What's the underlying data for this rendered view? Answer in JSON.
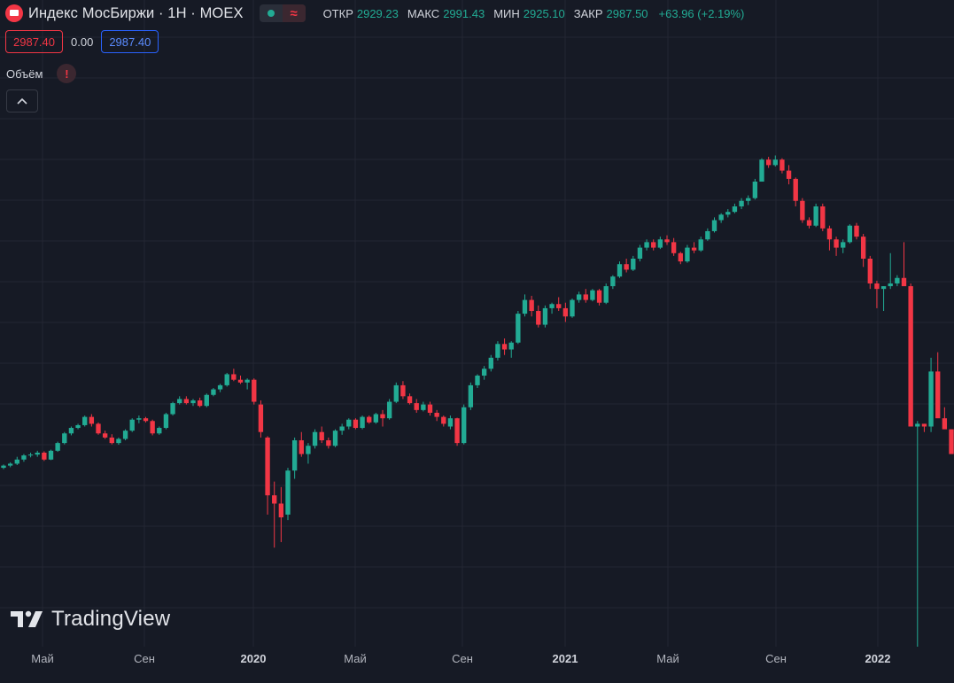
{
  "header": {
    "title": "Индекс МосБиржи · 1Н · MOEX",
    "ohlc": [
      {
        "key": "ОТКР",
        "value": "2929.23"
      },
      {
        "key": "МАКС",
        "value": "2991.43"
      },
      {
        "key": "МИН",
        "value": "2925.10"
      },
      {
        "key": "ЗАКР",
        "value": "2987.50"
      }
    ],
    "change": "+63.96 (+2.19%)"
  },
  "trade": {
    "sell": "2987.40",
    "spread": "0.00",
    "buy": "2987.40"
  },
  "volume": {
    "label": "Объём",
    "warning": "!"
  },
  "brand": {
    "name": "TradingView"
  },
  "colors": {
    "background": "#161a25",
    "grid": "#232632",
    "up": "#22ab94",
    "down": "#f23645"
  },
  "chart_data": {
    "type": "candlestick",
    "x_ticks": [
      {
        "label": "Май",
        "year": false
      },
      {
        "label": "Сен",
        "year": false
      },
      {
        "label": "2020",
        "year": true
      },
      {
        "label": "Май",
        "year": false
      },
      {
        "label": "Сен",
        "year": false
      },
      {
        "label": "2021",
        "year": true
      },
      {
        "label": "Май",
        "year": false
      },
      {
        "label": "Сен",
        "year": false
      },
      {
        "label": "2022",
        "year": true
      }
    ],
    "ylim": [
      2000,
      4350
    ],
    "grid": true,
    "candles": [
      [
        2650,
        2662,
        2645,
        2658
      ],
      [
        2658,
        2670,
        2652,
        2665
      ],
      [
        2665,
        2690,
        2660,
        2680
      ],
      [
        2680,
        2700,
        2672,
        2695
      ],
      [
        2695,
        2705,
        2688,
        2698
      ],
      [
        2698,
        2712,
        2690,
        2705
      ],
      [
        2705,
        2710,
        2675,
        2680
      ],
      [
        2680,
        2716,
        2678,
        2712
      ],
      [
        2712,
        2745,
        2708,
        2740
      ],
      [
        2740,
        2780,
        2735,
        2775
      ],
      [
        2775,
        2800,
        2768,
        2795
      ],
      [
        2795,
        2810,
        2790,
        2805
      ],
      [
        2805,
        2840,
        2800,
        2835
      ],
      [
        2835,
        2845,
        2800,
        2810
      ],
      [
        2810,
        2815,
        2770,
        2775
      ],
      [
        2775,
        2785,
        2755,
        2760
      ],
      [
        2760,
        2772,
        2735,
        2740
      ],
      [
        2740,
        2760,
        2734,
        2755
      ],
      [
        2755,
        2790,
        2750,
        2785
      ],
      [
        2785,
        2830,
        2780,
        2825
      ],
      [
        2825,
        2840,
        2812,
        2830
      ],
      [
        2830,
        2835,
        2815,
        2820
      ],
      [
        2820,
        2825,
        2768,
        2775
      ],
      [
        2775,
        2800,
        2770,
        2795
      ],
      [
        2795,
        2850,
        2790,
        2845
      ],
      [
        2845,
        2890,
        2840,
        2885
      ],
      [
        2885,
        2910,
        2880,
        2900
      ],
      [
        2900,
        2910,
        2880,
        2885
      ],
      [
        2885,
        2900,
        2875,
        2895
      ],
      [
        2895,
        2905,
        2870,
        2875
      ],
      [
        2875,
        2920,
        2870,
        2915
      ],
      [
        2915,
        2940,
        2910,
        2935
      ],
      [
        2935,
        2955,
        2925,
        2950
      ],
      [
        2950,
        2995,
        2945,
        2990
      ],
      [
        2990,
        3010,
        2965,
        2970
      ],
      [
        2970,
        2985,
        2955,
        2960
      ],
      [
        2960,
        2975,
        2935,
        2970
      ],
      [
        2970,
        2975,
        2880,
        2890
      ],
      [
        2880,
        2895,
        2760,
        2780
      ],
      [
        2760,
        2765,
        2480,
        2550
      ],
      [
        2550,
        2600,
        2360,
        2520
      ],
      [
        2520,
        2580,
        2380,
        2470
      ],
      [
        2480,
        2650,
        2460,
        2640
      ],
      [
        2640,
        2760,
        2610,
        2750
      ],
      [
        2750,
        2780,
        2690,
        2700
      ],
      [
        2700,
        2740,
        2665,
        2730
      ],
      [
        2730,
        2790,
        2720,
        2780
      ],
      [
        2780,
        2800,
        2740,
        2750
      ],
      [
        2750,
        2760,
        2720,
        2730
      ],
      [
        2730,
        2790,
        2725,
        2785
      ],
      [
        2785,
        2810,
        2770,
        2800
      ],
      [
        2800,
        2830,
        2790,
        2825
      ],
      [
        2825,
        2830,
        2790,
        2795
      ],
      [
        2795,
        2840,
        2790,
        2835
      ],
      [
        2835,
        2840,
        2810,
        2815
      ],
      [
        2815,
        2850,
        2810,
        2845
      ],
      [
        2845,
        2860,
        2800,
        2830
      ],
      [
        2830,
        2900,
        2825,
        2890
      ],
      [
        2890,
        2960,
        2885,
        2950
      ],
      [
        2950,
        2965,
        2900,
        2910
      ],
      [
        2910,
        2920,
        2880,
        2885
      ],
      [
        2885,
        2900,
        2850,
        2860
      ],
      [
        2860,
        2890,
        2855,
        2880
      ],
      [
        2880,
        2890,
        2840,
        2850
      ],
      [
        2850,
        2860,
        2820,
        2835
      ],
      [
        2835,
        2840,
        2800,
        2810
      ],
      [
        2800,
        2840,
        2790,
        2830
      ],
      [
        2830,
        2832,
        2730,
        2740
      ],
      [
        2740,
        2880,
        2735,
        2870
      ],
      [
        2870,
        2960,
        2860,
        2950
      ],
      [
        2950,
        2990,
        2940,
        2985
      ],
      [
        2985,
        3020,
        2970,
        3010
      ],
      [
        3010,
        3060,
        3000,
        3050
      ],
      [
        3050,
        3110,
        3040,
        3100
      ],
      [
        3100,
        3120,
        3060,
        3080
      ],
      [
        3080,
        3110,
        3050,
        3105
      ],
      [
        3105,
        3220,
        3100,
        3210
      ],
      [
        3210,
        3280,
        3200,
        3260
      ],
      [
        3260,
        3275,
        3200,
        3220
      ],
      [
        3220,
        3240,
        3160,
        3170
      ],
      [
        3170,
        3240,
        3160,
        3230
      ],
      [
        3230,
        3250,
        3210,
        3245
      ],
      [
        3245,
        3270,
        3220,
        3230
      ],
      [
        3230,
        3250,
        3180,
        3200
      ],
      [
        3200,
        3265,
        3195,
        3260
      ],
      [
        3260,
        3290,
        3250,
        3280
      ],
      [
        3280,
        3300,
        3250,
        3260
      ],
      [
        3260,
        3300,
        3255,
        3295
      ],
      [
        3295,
        3300,
        3240,
        3250
      ],
      [
        3250,
        3320,
        3245,
        3310
      ],
      [
        3310,
        3350,
        3300,
        3345
      ],
      [
        3345,
        3400,
        3340,
        3390
      ],
      [
        3390,
        3410,
        3360,
        3370
      ],
      [
        3370,
        3420,
        3365,
        3410
      ],
      [
        3410,
        3460,
        3400,
        3450
      ],
      [
        3450,
        3480,
        3440,
        3470
      ],
      [
        3470,
        3480,
        3440,
        3450
      ],
      [
        3450,
        3490,
        3445,
        3480
      ],
      [
        3480,
        3495,
        3460,
        3470
      ],
      [
        3470,
        3485,
        3420,
        3430
      ],
      [
        3430,
        3435,
        3390,
        3400
      ],
      [
        3400,
        3460,
        3395,
        3450
      ],
      [
        3450,
        3470,
        3430,
        3440
      ],
      [
        3440,
        3490,
        3435,
        3480
      ],
      [
        3480,
        3520,
        3475,
        3510
      ],
      [
        3510,
        3560,
        3505,
        3550
      ],
      [
        3550,
        3575,
        3540,
        3570
      ],
      [
        3570,
        3590,
        3560,
        3580
      ],
      [
        3580,
        3610,
        3575,
        3600
      ],
      [
        3600,
        3630,
        3590,
        3620
      ],
      [
        3620,
        3640,
        3605,
        3630
      ],
      [
        3630,
        3700,
        3625,
        3690
      ],
      [
        3690,
        3775,
        3690,
        3770
      ],
      [
        3770,
        3780,
        3740,
        3750
      ],
      [
        3750,
        3785,
        3745,
        3770
      ],
      [
        3770,
        3775,
        3720,
        3730
      ],
      [
        3730,
        3750,
        3680,
        3700
      ],
      [
        3700,
        3705,
        3600,
        3620
      ],
      [
        3620,
        3630,
        3540,
        3550
      ],
      [
        3550,
        3560,
        3520,
        3530
      ],
      [
        3530,
        3610,
        3525,
        3600
      ],
      [
        3600,
        3610,
        3510,
        3520
      ],
      [
        3520,
        3530,
        3440,
        3480
      ],
      [
        3480,
        3490,
        3420,
        3450
      ],
      [
        3450,
        3480,
        3430,
        3470
      ],
      [
        3470,
        3535,
        3465,
        3530
      ],
      [
        3530,
        3540,
        3480,
        3490
      ],
      [
        3490,
        3500,
        3380,
        3410
      ],
      [
        3410,
        3420,
        3300,
        3320
      ],
      [
        3320,
        3330,
        3230,
        3300
      ],
      [
        3300,
        3310,
        3220,
        3310
      ],
      [
        3310,
        3430,
        3300,
        3320
      ],
      [
        3320,
        3350,
        3310,
        3340
      ],
      [
        3340,
        3470,
        3330,
        3310
      ],
      [
        3310,
        3320,
        2800,
        2800
      ],
      [
        2800,
        2820,
        1870,
        2810
      ],
      [
        2810,
        2810,
        2780,
        2800
      ],
      [
        2800,
        3050,
        2780,
        3000
      ],
      [
        3000,
        3070,
        2900,
        2830
      ],
      [
        2830,
        2870,
        2800,
        2790
      ],
      [
        2790,
        2790,
        2700,
        2700
      ]
    ]
  }
}
